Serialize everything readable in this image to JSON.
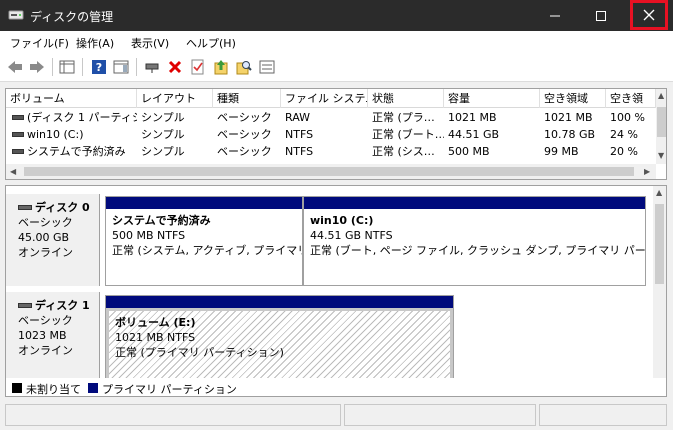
{
  "window": {
    "title": "ディスクの管理"
  },
  "menu": [
    "ファイル(F)",
    "操作(A)",
    "表示(V)",
    "ヘルプ(H)"
  ],
  "volume_table": {
    "columns": [
      "ボリューム",
      "レイアウト",
      "種類",
      "ファイル システム",
      "状態",
      "容量",
      "空き領域",
      "空き領"
    ],
    "rows": [
      [
        "(ディスク 1 パーティシ…",
        "シンプル",
        "ベーシック",
        "RAW",
        "正常 (プラ…",
        "1021 MB",
        "1021 MB",
        "100 %"
      ],
      [
        "win10 (C:)",
        "シンプル",
        "ベーシック",
        "NTFS",
        "正常 (ブート…",
        "44.51 GB",
        "10.78 GB",
        "24 %"
      ],
      [
        "システムで予約済み",
        "シンプル",
        "ベーシック",
        "NTFS",
        "正常 (シス…",
        "500 MB",
        "99 MB",
        "20 %"
      ]
    ]
  },
  "disks": [
    {
      "name": "ディスク 0",
      "type": "ベーシック",
      "size": "45.00 GB",
      "status": "オンライン",
      "partitions": [
        {
          "name": "システムで予約済み",
          "size": "500 MB NTFS",
          "status": "正常 (システム, アクティブ, プライマリ パー"
        },
        {
          "name": "win10  (C:)",
          "size": "44.51 GB NTFS",
          "status": "正常 (ブート, ページ ファイル, クラッシュ ダンプ, プライマリ パーティション)"
        }
      ]
    },
    {
      "name": "ディスク 1",
      "type": "ベーシック",
      "size": "1023 MB",
      "status": "オンライン",
      "partitions": [
        {
          "name": "ボリューム  (E:)",
          "size": "1021 MB NTFS",
          "status": "正常 (プライマリ パーティション)"
        }
      ]
    }
  ],
  "legend": [
    {
      "label": "未割り当て",
      "color": "#000000"
    },
    {
      "label": "プライマリ パーティション",
      "color": "#000a7c"
    }
  ],
  "colors": {
    "titlebar": "#2b2b2b",
    "close_highlight": "#e81123",
    "partition_bar": "#000a7c"
  },
  "icons": [
    "back-arrow-icon",
    "forward-arrow-icon",
    "console-tree-icon",
    "help-icon",
    "action-pane-icon",
    "connect-drive-icon",
    "delete-icon",
    "properties-icon",
    "format-icon",
    "search-icon",
    "settings-icon"
  ]
}
